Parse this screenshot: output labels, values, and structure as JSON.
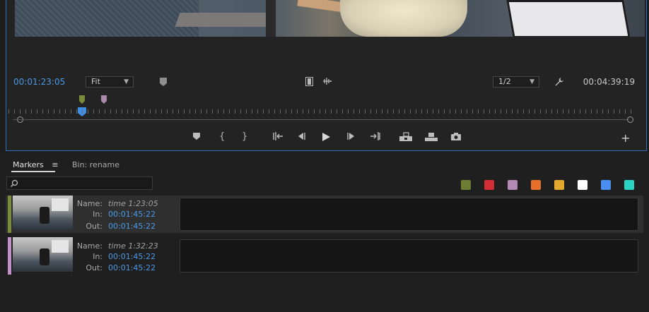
{
  "monitor": {
    "timecode_current": "00:01:23:05",
    "timecode_total": "00:04:39:19",
    "fit": "Fit",
    "resolution": "1/2",
    "icons": {
      "add_marker": "marker-icon",
      "export_frame": "film-icon",
      "audio": "waveform-icon",
      "settings": "wrench-icon",
      "add": "plus-icon"
    },
    "controls": [
      {
        "name": "add-marker-button",
        "glyph": "⬟"
      },
      {
        "name": "mark-in-button",
        "glyph": "{"
      },
      {
        "name": "mark-out-button",
        "glyph": "}"
      },
      {
        "name": "go-to-in-button",
        "glyph": "⇤"
      },
      {
        "name": "step-back-button",
        "glyph": "◀"
      },
      {
        "name": "play-button",
        "glyph": "▶"
      },
      {
        "name": "step-forward-button",
        "glyph": "▶"
      },
      {
        "name": "go-to-out-button",
        "glyph": "⇥"
      },
      {
        "name": "insert-button",
        "glyph": "⊞"
      },
      {
        "name": "overwrite-button",
        "glyph": "⊟"
      },
      {
        "name": "export-frame-button",
        "glyph": "◉"
      }
    ],
    "marker_colors": [
      "#7a8c3a",
      "#a98aa8"
    ],
    "playhead_color": "#3f8ee3"
  },
  "panel": {
    "tabs": [
      {
        "label": "Markers"
      },
      {
        "label": "Bin: rename"
      }
    ],
    "menu_icon": "hamburger-icon",
    "search_icon": "search-icon",
    "swatches": [
      "#6f7c33",
      "#d22c35",
      "#b28ab3",
      "#e8702a",
      "#e2a92e",
      "#ffffff",
      "#4a8ff0",
      "#29d4c2"
    ],
    "markers": [
      {
        "color": "#7a8c3a",
        "name_label": "Name:",
        "name": "time 1:23:05",
        "in_label": "In:",
        "in": "00:01:45:22",
        "out_label": "Out:",
        "out": "00:01:45:22"
      },
      {
        "color": "#c391c7",
        "name_label": "Name:",
        "name": "time 1:32:23",
        "in_label": "In:",
        "in": "00:01:45:22",
        "out_label": "Out:",
        "out": "00:01:45:22"
      }
    ]
  }
}
